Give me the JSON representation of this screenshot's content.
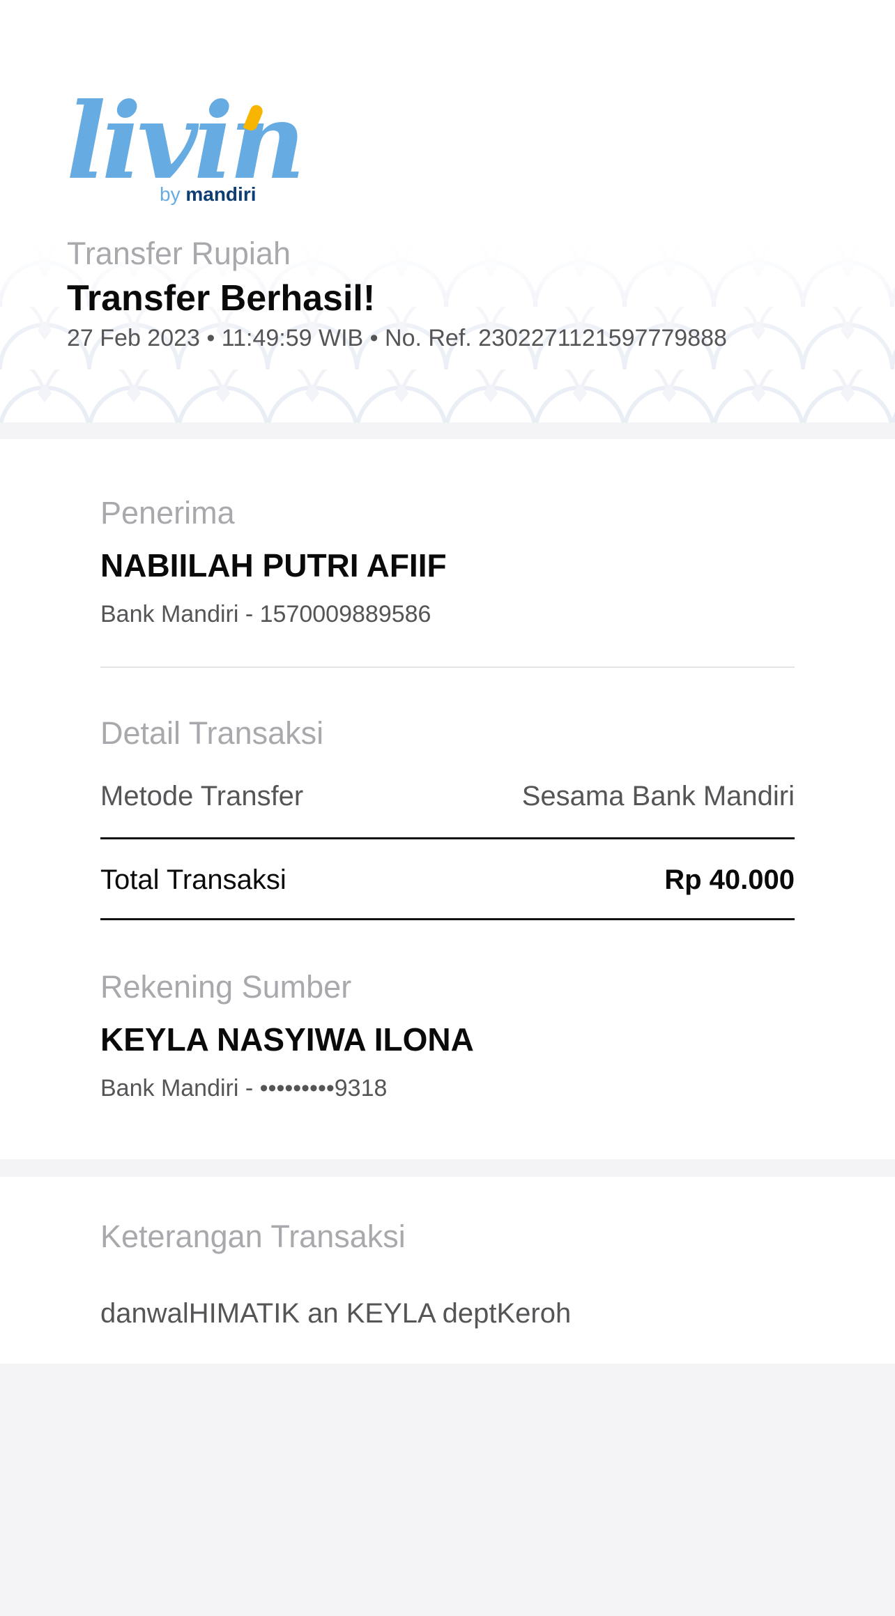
{
  "brand": {
    "logo_word": "livin",
    "logo_by": "by",
    "logo_bank": "mandiri",
    "primary_color": "#66ace2",
    "accent_color": "#f7b500",
    "bank_color": "#0d3d73"
  },
  "header": {
    "subtitle": "Transfer Rupiah",
    "title": "Transfer Berhasil!",
    "meta": "27 Feb 2023 • 11:49:59 WIB • No. Ref. 2302271121597779888"
  },
  "recipient": {
    "label": "Penerima",
    "name": "NABIILAH PUTRI AFIIF",
    "bank_account": "Bank Mandiri - 1570009889586"
  },
  "details": {
    "label": "Detail Transaksi",
    "method_label": "Metode Transfer",
    "method_value": "Sesama Bank Mandiri",
    "total_label": "Total Transaksi",
    "total_value": "Rp 40.000"
  },
  "source": {
    "label": "Rekening Sumber",
    "name": "KEYLA NASYIWA ILONA",
    "bank_account": "Bank Mandiri - •••••••••9318"
  },
  "note": {
    "label": "Keterangan Transaksi",
    "text": "danwalHIMATIK an KEYLA deptKeroh"
  }
}
